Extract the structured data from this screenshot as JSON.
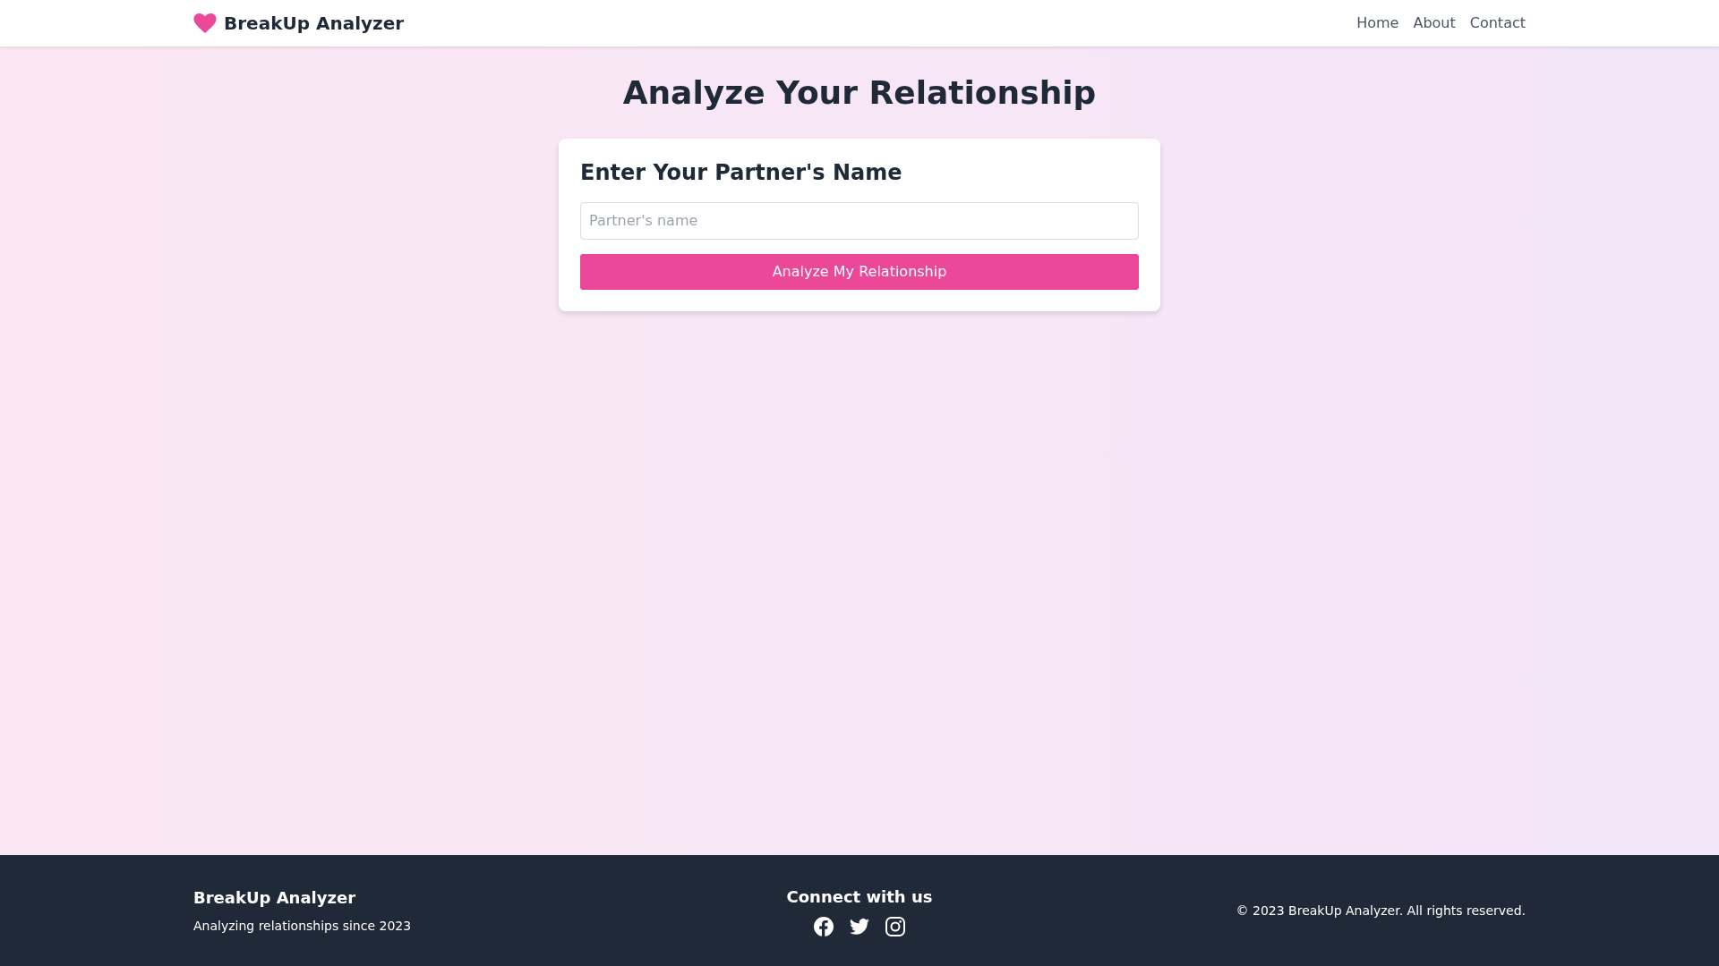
{
  "navbar": {
    "brand": "BreakUp Analyzer",
    "links": [
      {
        "label": "Home"
      },
      {
        "label": "About"
      },
      {
        "label": "Contact"
      }
    ]
  },
  "page_title": "Analyze Your Relationship",
  "form": {
    "heading": "Enter Your Partner's Name",
    "input": {
      "placeholder": "Partner's name"
    },
    "button": "Analyze My Relationship"
  },
  "footer": {
    "brand": "BreakUp Analyzer",
    "tagline": "Analyzing relationships since 2023",
    "connect_heading": "Connect with us",
    "social": [
      {
        "kind": "facebook"
      },
      {
        "kind": "twitter"
      },
      {
        "kind": "instagram"
      }
    ],
    "copyright": "© 2023 BreakUp Analyzer. All rights reserved."
  }
}
